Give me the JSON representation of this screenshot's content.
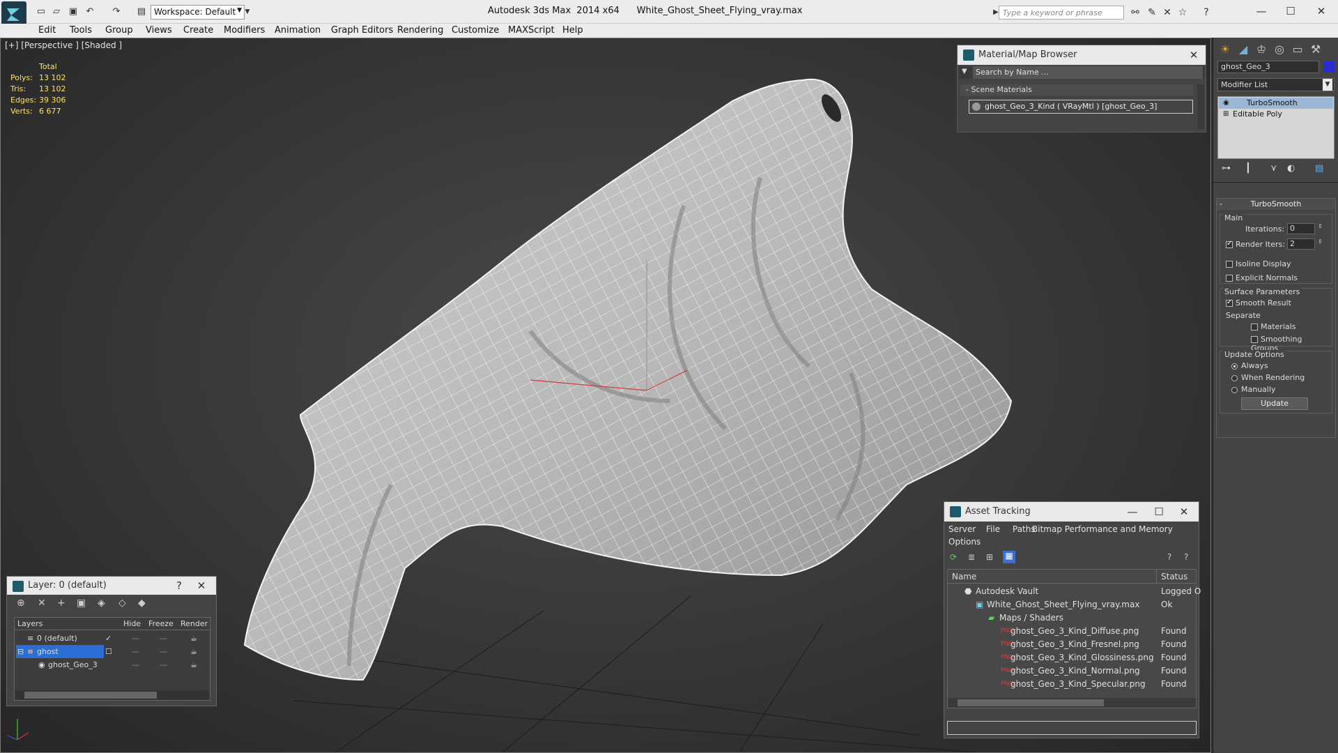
{
  "title_bar": {
    "workspace": "Workspace: Default",
    "window_title": "Autodesk 3ds Max  2014 x64      White_Ghost_Sheet_Flying_vray.max",
    "search_placeholder": "Type a keyword or phrase"
  },
  "menu": [
    "Edit",
    "Tools",
    "Group",
    "Views",
    "Create",
    "Modifiers",
    "Animation",
    "Graph Editors",
    "Rendering",
    "Customize",
    "MAXScript",
    "Help"
  ],
  "viewport": {
    "label": "[+] [Perspective ] [Shaded ]",
    "stats_header": "Total",
    "stats": [
      {
        "label": "Polys:",
        "value": "13 102"
      },
      {
        "label": "Tris:",
        "value": "13 102"
      },
      {
        "label": "Edges:",
        "value": "39 306"
      },
      {
        "label": "Verts:",
        "value": "6 677"
      }
    ]
  },
  "material_browser": {
    "title": "Material/Map Browser",
    "search_placeholder": "Search by Name ...",
    "section": "Scene Materials",
    "item": "ghost_Geo_3_Kind  ( VRayMtl ) [ghost_Geo_3]"
  },
  "command_panel": {
    "object_name": "ghost_Geo_3",
    "color": "#2b2bd6",
    "modifier_list": "Modifier List",
    "stack": [
      "TurboSmooth",
      "Editable Poly"
    ],
    "rollout_title": "TurboSmooth",
    "main_label": "Main",
    "iterations_label": "Iterations:",
    "iterations_value": "0",
    "render_iters_label": "Render Iters:",
    "render_iters_value": "2",
    "isoline": "Isoline Display",
    "explicit": "Explicit Normals",
    "surface_label": "Surface Parameters",
    "smooth_result": "Smooth Result",
    "separate_label": "Separate",
    "materials": "Materials",
    "smoothing_groups": "Smoothing Groups",
    "update_label": "Update Options",
    "always": "Always",
    "when_rendering": "When Rendering",
    "manually": "Manually",
    "update_button": "Update"
  },
  "asset_tracking": {
    "title": "Asset Tracking",
    "menu": [
      "Server",
      "File",
      "Paths",
      "Bitmap Performance and Memory",
      "Options"
    ],
    "col_name": "Name",
    "col_status": "Status",
    "rows": [
      {
        "name": "Autodesk Vault",
        "status": "Logged O"
      },
      {
        "name": "White_Ghost_Sheet_Flying_vray.max",
        "status": "Ok"
      },
      {
        "name": "Maps / Shaders",
        "status": ""
      },
      {
        "name": "ghost_Geo_3_Kind_Diffuse.png",
        "status": "Found"
      },
      {
        "name": "ghost_Geo_3_Kind_Fresnel.png",
        "status": "Found"
      },
      {
        "name": "ghost_Geo_3_Kind_Glossiness.png",
        "status": "Found"
      },
      {
        "name": "ghost_Geo_3_Kind_Normal.png",
        "status": "Found"
      },
      {
        "name": "ghost_Geo_3_Kind_Specular.png",
        "status": "Found"
      }
    ]
  },
  "layer_panel": {
    "title": "Layer: 0 (default)",
    "help": "?",
    "col_layers": "Layers",
    "col_hide": "Hide",
    "col_freeze": "Freeze",
    "col_render": "Render",
    "rows": [
      {
        "name": "0 (default)"
      },
      {
        "name": "ghost"
      },
      {
        "name": "ghost_Geo_3"
      }
    ]
  }
}
